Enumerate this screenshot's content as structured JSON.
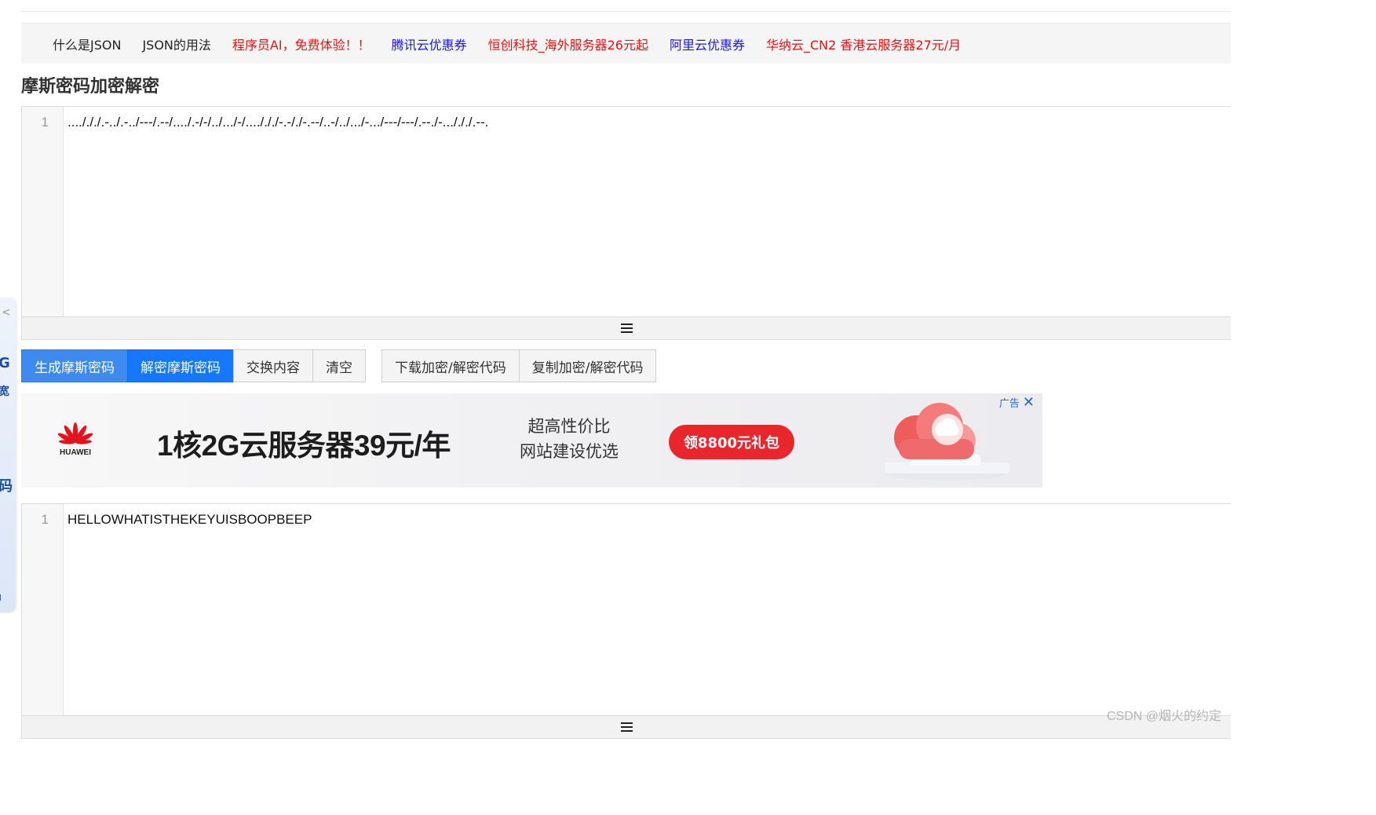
{
  "nav": {
    "items": [
      {
        "label": "什么是JSON",
        "color": "#222222"
      },
      {
        "label": "JSON的用法",
        "color": "#222222"
      },
      {
        "label": "程序员AI，免费体验！！",
        "color": "#e8130f"
      },
      {
        "label": "腾讯云优惠券",
        "color": "#1a1ad8"
      },
      {
        "label": "恒创科技_海外服务器26元起",
        "color": "#e8130f"
      },
      {
        "label": "阿里云优惠券",
        "color": "#1a1ad8"
      },
      {
        "label": "华纳云_CN2 香港云服务器27元/月",
        "color": "#e8130f"
      }
    ]
  },
  "page": {
    "title": "摩斯密码加密解密"
  },
  "input_editor": {
    "line_number": "1",
    "content": "..../././.-../.-../---/.--/..../.-/-/../.../-/..../././-.-/./-.--/..-/../.../-.../---/---/.--./-.../././.--."
  },
  "buttons": {
    "encode": "生成摩斯密码",
    "decode": "解密摩斯密码",
    "swap": "交换内容",
    "clear": "清空",
    "download_code": "下载加密/解密代码",
    "copy_code": "复制加密/解密代码"
  },
  "ad": {
    "brand": "HUAWEI",
    "headline": "1核2G云服务器39元/年",
    "sub_line1": "超高性价比",
    "sub_line2": "网站建设优选",
    "cta": "领8800元礼包",
    "label": "广告",
    "close_icon": "close-icon"
  },
  "output_editor": {
    "line_number": "1",
    "content": "HELLOWHATISTHEKEYUISBOOPBEEP"
  },
  "side_widget": {
    "glyphs": [
      "G",
      "宽",
      "码",
      "l"
    ]
  },
  "watermark": "CSDN @烟火的约定",
  "colors": {
    "primary_button": "#1677ff",
    "link_red": "#e8130f",
    "link_blue": "#1a1ad8",
    "ad_cta": "#e8262b"
  }
}
